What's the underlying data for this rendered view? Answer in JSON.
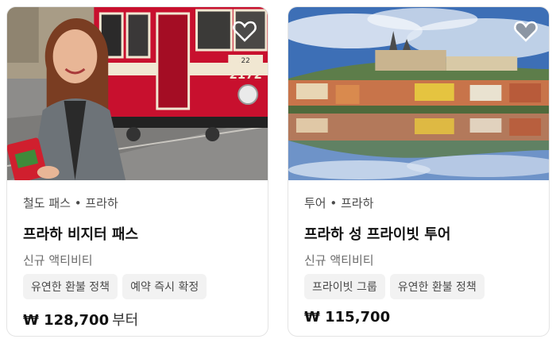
{
  "cards": [
    {
      "category": "철도 패스 • 프라하",
      "title": "프라하 비지터 패스",
      "subtitle": "신규 액티비티",
      "tags": [
        "유연한 환불 정책",
        "예약 즉시 확정"
      ],
      "price": "₩ 128,700",
      "price_suffix": "부터",
      "tram_number": "2172",
      "tram_small": "22",
      "image_icon": "woman-with-tram-photo",
      "wishlist_icon": "heart-icon"
    },
    {
      "category": "투어 • 프라하",
      "title": "프라하 성 프라이빗 투어",
      "subtitle": "신규 액티비티",
      "tags": [
        "프라이빗 그룹",
        "유연한 환불 정책"
      ],
      "price": "₩ 115,700",
      "price_suffix": "",
      "image_icon": "prague-castle-reflection-photo",
      "wishlist_icon": "heart-icon"
    }
  ],
  "colors": {
    "tram_red": "#c8102e",
    "sky_blue": "#3d6fb6",
    "card_border": "#e4e4e4",
    "tag_bg": "#f2f2f2"
  }
}
